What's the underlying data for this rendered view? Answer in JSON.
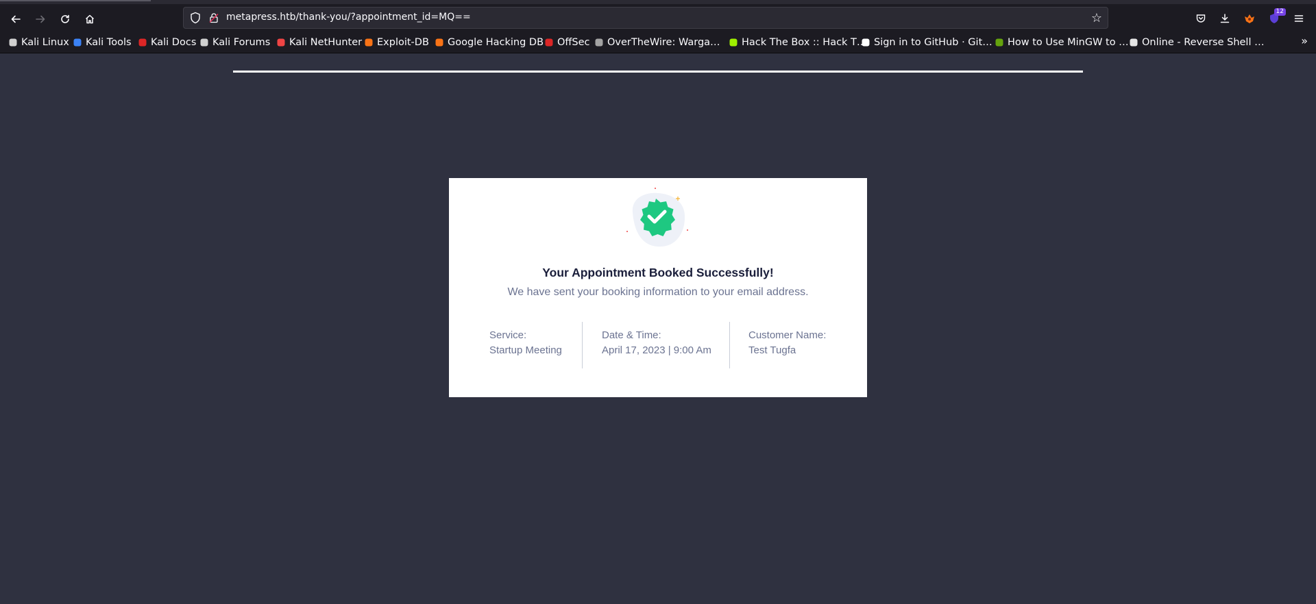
{
  "browser": {
    "url": "metapress.htb/thank-you/?appointment_id=MQ==",
    "extensions_badge": "12"
  },
  "bookmarks": [
    {
      "label": "Kali Linux",
      "icon": "kali-dragon-icon",
      "color": "#d0d0d0"
    },
    {
      "label": "Kali Tools",
      "icon": "kali-tools-icon",
      "color": "#3b82f6"
    },
    {
      "label": "Kali Docs",
      "icon": "kali-docs-icon",
      "color": "#dc2626"
    },
    {
      "label": "Kali Forums",
      "icon": "kali-forums-icon",
      "color": "#d0d0d0"
    },
    {
      "label": "Kali NetHunter",
      "icon": "nethunter-icon",
      "color": "#ef4444"
    },
    {
      "label": "Exploit-DB",
      "icon": "exploit-db-icon",
      "color": "#f97316"
    },
    {
      "label": "Google Hacking DB",
      "icon": "ghdb-icon",
      "color": "#f97316"
    },
    {
      "label": "OffSec",
      "icon": "offsec-icon",
      "color": "#dc2626"
    },
    {
      "label": "OverTheWire: Warga…",
      "icon": "overthewire-icon",
      "color": "#a3a3a3"
    },
    {
      "label": "Hack The Box :: Hack T…",
      "icon": "hackthebox-icon",
      "color": "#9fef00"
    },
    {
      "label": "Sign in to GitHub · Git…",
      "icon": "github-icon",
      "color": "#ffffff"
    },
    {
      "label": "How to Use MinGW to …",
      "icon": "mingw-icon",
      "color": "#65a30d"
    },
    {
      "label": "Online - Reverse Shell …",
      "icon": "skull-icon",
      "color": "#e5e5e5"
    }
  ],
  "card": {
    "title": "Your Appointment Booked Successfully!",
    "subtitle": "We have sent your booking information to your email address.",
    "service_label": "Service:",
    "service_value": "Startup Meeting",
    "datetime_label": "Date & Time:",
    "datetime_value": "April 17, 2023 | 9:00 Am",
    "customer_label": "Customer Name:",
    "customer_value": "Test Tugfa"
  },
  "colors": {
    "page_bg": "#2f3140",
    "success_green": "#1ec881",
    "title_text": "#1b1f3b",
    "muted_text": "#6b7391"
  }
}
